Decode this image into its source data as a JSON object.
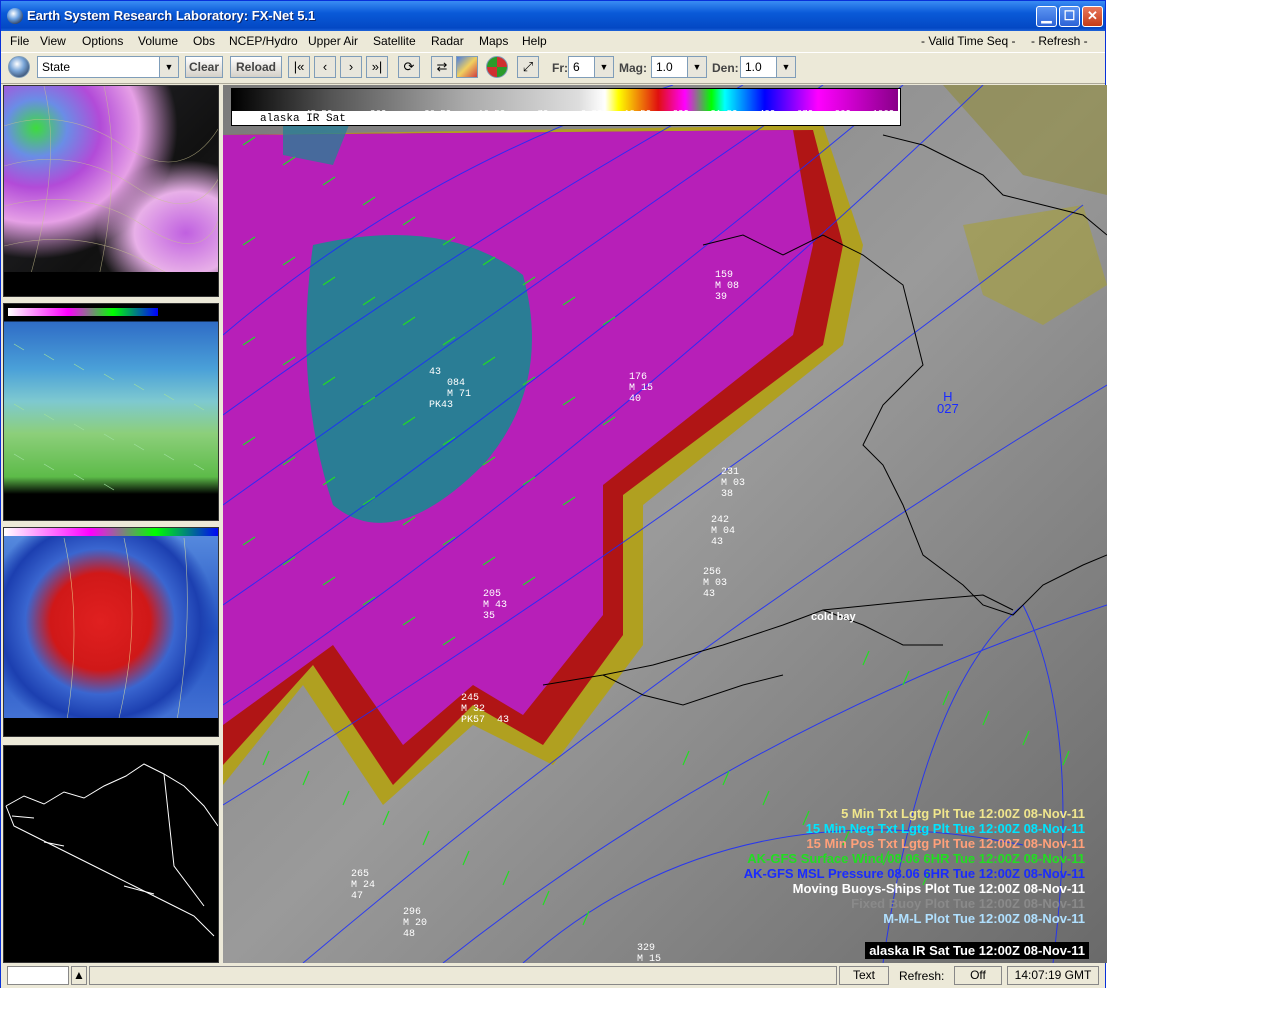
{
  "window": {
    "title": "Earth System Research Laboratory: FX-Net 5.1",
    "min_glyph": "▁",
    "max_glyph": "☐",
    "close_glyph": "✕"
  },
  "menu": {
    "items": [
      "File",
      "View",
      "Options",
      "Volume",
      "Obs",
      "NCEP/Hydro",
      "Upper Air",
      "Satellite",
      "Radar",
      "Maps",
      "Help"
    ],
    "right": [
      "- Valid Time Seq -",
      "- Refresh -"
    ]
  },
  "toolbar": {
    "region_value": "State",
    "clear_label": "Clear",
    "reload_label": "Reload",
    "fr_label": "Fr:",
    "fr_value": "6",
    "mag_label": "Mag:",
    "mag_value": "1.0",
    "den_label": "Den:",
    "den_value": "1.0",
    "icons": [
      "globe-icon",
      "first-frame-icon",
      "prev-frame-icon",
      "next-frame-icon",
      "last-frame-icon",
      "loop-icon",
      "swap-icon",
      "image-settings-icon",
      "crosshair-icon",
      "zoom-icon"
    ]
  },
  "colorbar": {
    "labels": [
      "45.5C",
      "36C",
      "26.5C",
      "16.5C",
      "7C",
      "-2.5C",
      "-12.5C",
      "-22C",
      "-31.5C",
      "-48C",
      "-67C",
      "-86C",
      "-106C"
    ],
    "product": "alaska IR Sat"
  },
  "legend": {
    "lines": [
      {
        "text": "5 Min Txt Lgtg Plt Tue 12:00Z 08-Nov-11",
        "color": "#f0e68c"
      },
      {
        "text": "15 Min Neg Txt Lgtg Plt Tue 12:00Z 08-Nov-11",
        "color": "#00e5ff"
      },
      {
        "text": "15 Min Pos Txt Lgtg Plt Tue 12:00Z 08-Nov-11",
        "color": "#ffa07a"
      },
      {
        "text": "AK-GFS Surface Wind  08.06   6HR Tue 12:00Z 08-Nov-11",
        "color": "#22dd22"
      },
      {
        "text": "AK-GFS MSL Pressure  08.06   6HR Tue 12:00Z 08-Nov-11",
        "color": "#1a2bff"
      },
      {
        "text": "Moving Buoys-Ships Plot Tue 12:00Z 08-Nov-11",
        "color": "#ffffff"
      },
      {
        "text": "Fixed Buoy Plot Tue 12:00Z 08-Nov-11",
        "color": "#8a8a8a"
      },
      {
        "text": "M-M-L Plot Tue 12:00Z 08-Nov-11",
        "color": "#b0e0ff"
      }
    ],
    "frame_label": "alaska IR Sat Tue 12:00Z 08-Nov-11"
  },
  "map": {
    "place_label": "cold bay",
    "high_label": "H",
    "high_value": "027",
    "stations": [
      {
        "id": "PK43",
        "lines": [
          "43",
          "084",
          "M 71"
        ]
      },
      {
        "id": "",
        "lines": [
          "176",
          "M 15",
          "40"
        ]
      },
      {
        "id": "",
        "lines": [
          "159",
          "M 08",
          "39"
        ]
      },
      {
        "id": "",
        "lines": [
          "205",
          "M 43",
          "35"
        ]
      },
      {
        "id": "",
        "lines": [
          "231",
          "M 03",
          "38"
        ]
      },
      {
        "id": "",
        "lines": [
          "242",
          "M 04",
          "43"
        ]
      },
      {
        "id": "",
        "lines": [
          "256",
          "M 03",
          "43"
        ]
      },
      {
        "id": "PK57",
        "lines": [
          "245",
          "M 32",
          "43"
        ]
      },
      {
        "id": "",
        "lines": [
          "265",
          "M 24",
          "47"
        ]
      },
      {
        "id": "",
        "lines": [
          "296",
          "M 20",
          "48"
        ]
      },
      {
        "id": "",
        "lines": [
          "329",
          "M 15"
        ]
      }
    ]
  },
  "status": {
    "text_label": "Text",
    "refresh_label": "Refresh:",
    "refresh_value": "Off",
    "time": "14:07:19 GMT"
  }
}
